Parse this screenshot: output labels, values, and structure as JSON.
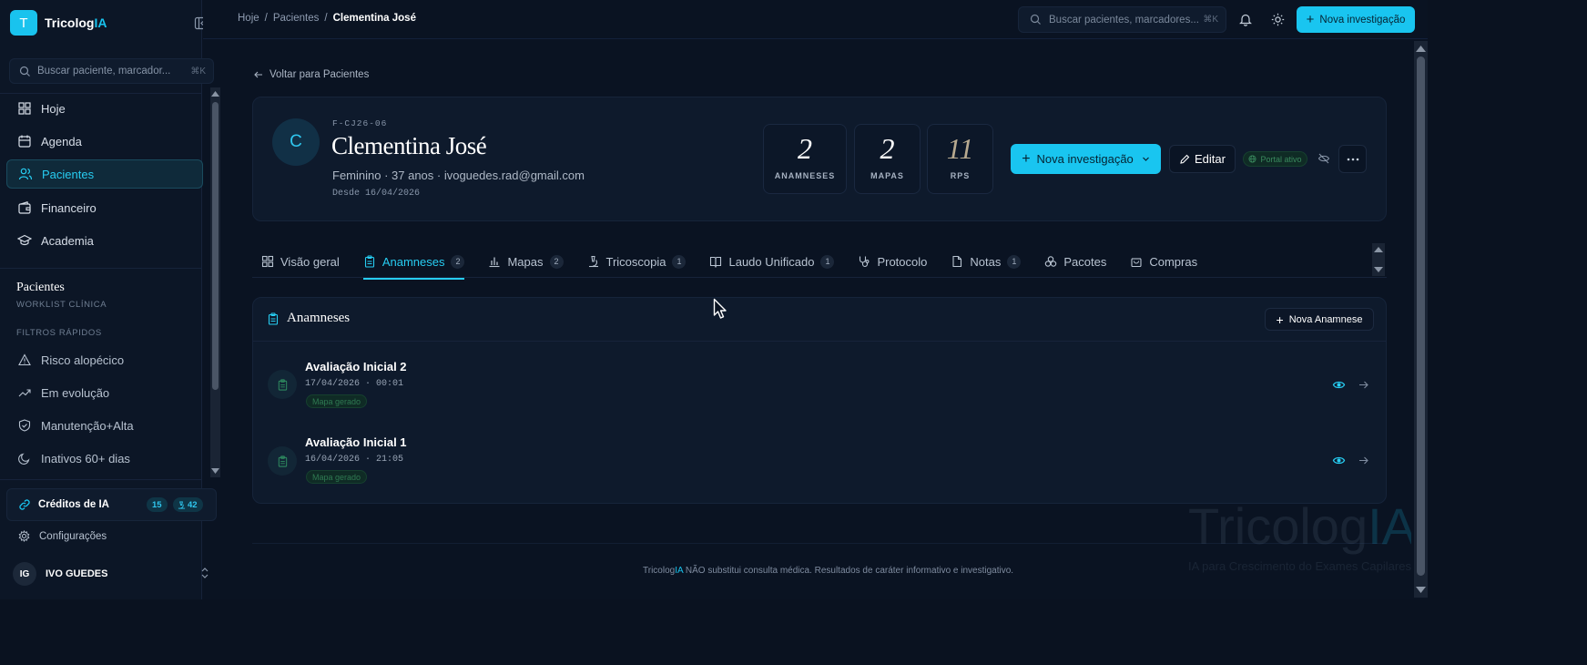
{
  "brand": {
    "logo_letter": "T",
    "name_main": "Tricolog",
    "name_accent": "IA"
  },
  "sidebar": {
    "search_placeholder": "Buscar paciente, marcador...",
    "search_shortcut": "⌘K",
    "nav": [
      {
        "label": "Hoje",
        "icon": "grid-icon"
      },
      {
        "label": "Agenda",
        "icon": "calendar-icon"
      },
      {
        "label": "Pacientes",
        "icon": "users-icon",
        "active": true
      },
      {
        "label": "Financeiro",
        "icon": "wallet-icon"
      },
      {
        "label": "Academia",
        "icon": "graduation-cap-icon"
      }
    ],
    "section_title": "Pacientes",
    "section_subtitle": "WORKLIST CLÍNICA",
    "filters_title": "FILTROS RÁPIDOS",
    "filters": [
      {
        "label": "Risco alopécico",
        "icon": "warning-icon"
      },
      {
        "label": "Em evolução",
        "icon": "trending-up-icon"
      },
      {
        "label": "Manutenção+Alta",
        "icon": "shield-check-icon"
      },
      {
        "label": "Inativos 60+ dias",
        "icon": "moon-icon"
      }
    ],
    "credits_label": "Créditos de IA",
    "credits_badge_1": "15",
    "credits_badge_2": "42",
    "settings_label": "Configurações",
    "user_initials": "IG",
    "user_name": "IVO GUEDES"
  },
  "topbar": {
    "breadcrumb": [
      "Hoje",
      "Pacientes",
      "Clementina José"
    ],
    "breadcrumb_sep": "/",
    "search_placeholder": "Buscar pacientes, marcadores...",
    "search_shortcut": "⌘K",
    "new_button": "Nova investigação"
  },
  "patient": {
    "back_label": "Voltar para Pacientes",
    "avatar_letter": "C",
    "code": "F-CJ26-06",
    "name": "Clementina José",
    "meta": "Feminino · 37 anos · ivoguedes.rad@gmail.com",
    "since": "Desde 16/04/2026",
    "stats": [
      {
        "value": "2",
        "label": "ANAMNESES"
      },
      {
        "value": "2",
        "label": "MAPAS"
      },
      {
        "value": "11",
        "label": "RPS"
      }
    ],
    "new_button": "Nova investigação",
    "edit_button": "Editar",
    "portal_badge": "Portal ativo"
  },
  "tabs": [
    {
      "label": "Visão geral",
      "count": "",
      "icon": "layout-icon"
    },
    {
      "label": "Anamneses",
      "count": "2",
      "icon": "clipboard-icon",
      "active": true
    },
    {
      "label": "Mapas",
      "count": "2",
      "icon": "bar-chart-icon"
    },
    {
      "label": "Tricoscopia",
      "count": "1",
      "icon": "microscope-icon"
    },
    {
      "label": "Laudo Unificado",
      "count": "1",
      "icon": "book-icon"
    },
    {
      "label": "Protocolo",
      "count": "",
      "icon": "stethoscope-icon"
    },
    {
      "label": "Notas",
      "count": "1",
      "icon": "file-icon"
    },
    {
      "label": "Pacotes",
      "count": "",
      "icon": "boxes-icon"
    },
    {
      "label": "Compras",
      "count": "",
      "icon": "shopping-bag-icon"
    }
  ],
  "anamneses": {
    "title": "Anamneses",
    "new_button": "Nova Anamnese",
    "items": [
      {
        "title": "Avaliação Inicial 2",
        "date": "17/04/2026 · 00:01",
        "tag": "Mapa gerado"
      },
      {
        "title": "Avaliação Inicial 1",
        "date": "16/04/2026 · 21:05",
        "tag": "Mapa gerado"
      }
    ]
  },
  "footer": {
    "brand_main": "Tricolog",
    "brand_accent": "IA",
    "text": " NÃO substitui consulta médica. Resultados de caráter informativo e investigativo."
  },
  "watermark": {
    "title_main": "Tricolog",
    "title_accent": "IA",
    "subtitle": "IA para Crescimento do Exames Capilares"
  },
  "colors": {
    "accent": "#19c5f0",
    "background": "#0a1322",
    "success": "#2f7a52"
  }
}
